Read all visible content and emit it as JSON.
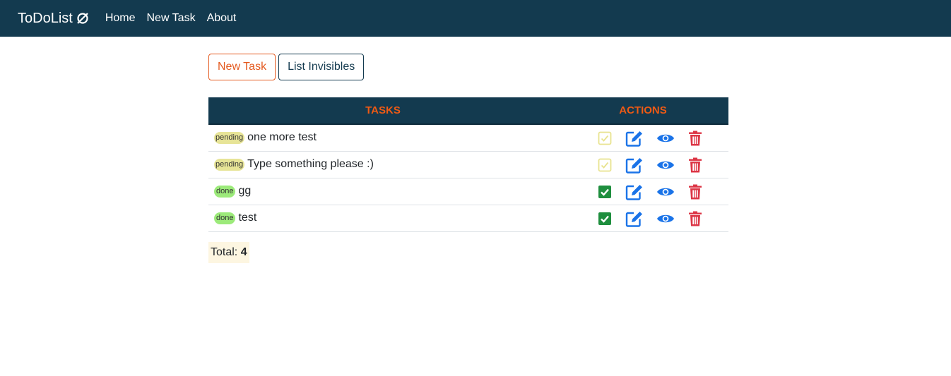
{
  "navbar": {
    "brand": "ToDoList",
    "brand_icon": "circle-slash-icon",
    "links": [
      "Home",
      "New Task",
      "About"
    ]
  },
  "toolbar": {
    "new_task_label": "New Task",
    "list_invisibles_label": "List Invisibles"
  },
  "table": {
    "headers": {
      "tasks": "TASKS",
      "actions": "ACTIONS"
    },
    "rows": [
      {
        "status": "pending",
        "text": "one more test",
        "done": false
      },
      {
        "status": "pending",
        "text": "Type something please :)",
        "done": false
      },
      {
        "status": "done",
        "text": "gg",
        "done": true
      },
      {
        "status": "done",
        "text": "test",
        "done": true
      }
    ]
  },
  "footer": {
    "total_label": "Total:",
    "total_value": "4"
  },
  "colors": {
    "navbar": "#133a4f",
    "accent": "#e4591e",
    "header_text": "#ef5a14",
    "pending_badge": "#e7e497",
    "done_badge": "#9cea7a",
    "edit_view_icon": "#1a73e8",
    "delete_icon": "#dc3545",
    "done_check": "#1e8e3e",
    "pending_check": "#e8e38f"
  }
}
